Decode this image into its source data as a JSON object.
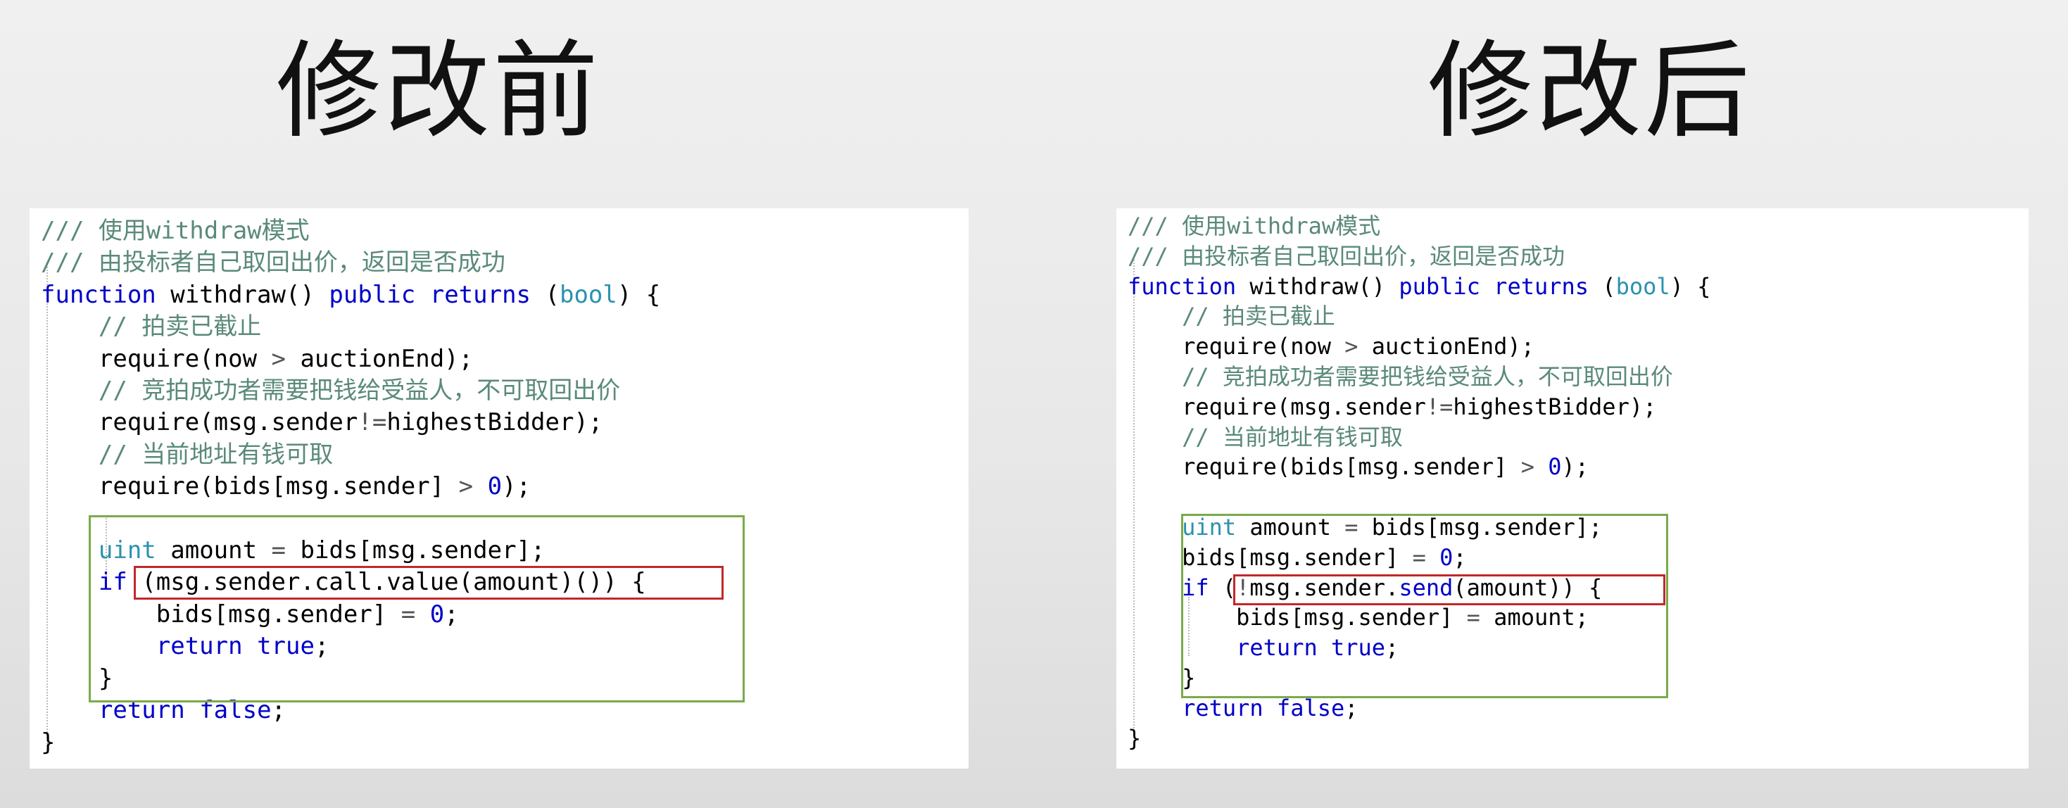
{
  "titles": {
    "before": "修改前",
    "after": "修改后"
  },
  "before": {
    "comment1": "/// 使用withdraw模式",
    "comment2": "/// 由投标者自己取回出价，返回是否成功",
    "kw_function": "function",
    "fn_name": " withdraw() ",
    "kw_public": "public",
    "kw_returns": "returns",
    "paren_open": " (",
    "tp_bool": "bool",
    "paren_close": ") {",
    "indent": "    ",
    "indent2": "        ",
    "comment3": "// 拍卖已截止",
    "req1_a": "require(now ",
    "gt": ">",
    "req1_b": " auctionEnd);",
    "comment4": "// 竞拍成功者需要把钱给受益人，不可取回出价",
    "req2_a": "require(msg.sender",
    "neq": "!=",
    "req2_b": "highestBidder);",
    "comment5": "// 当前地址有钱可取",
    "req3_a": "require(bids[msg.sender] ",
    "zero": "0",
    "req3_b": ");",
    "tp_uint": "uint",
    "amount_a": " amount ",
    "eq": "=",
    "amount_b": " bids[msg.sender];",
    "kw_if": "if",
    "if_cond": " (msg.sender.call.value(amount)()) {",
    "bids_a": "bids[msg.sender] ",
    "semi": ";",
    "kw_return": "return",
    "kw_true": " true",
    "close_brace": "}",
    "kw_false": " false"
  },
  "after": {
    "comment1": "/// 使用withdraw模式",
    "comment2": "/// 由投标者自己取回出价，返回是否成功",
    "kw_function": "function",
    "fn_name": " withdraw() ",
    "kw_public": "public",
    "kw_returns": "returns",
    "paren_open": " (",
    "tp_bool": "bool",
    "paren_close": ") {",
    "indent": "    ",
    "indent2": "        ",
    "comment3": "// 拍卖已截止",
    "req1_a": "require(now ",
    "gt": ">",
    "req1_b": " auctionEnd);",
    "comment4": "// 竞拍成功者需要把钱给受益人，不可取回出价",
    "req2_a": "require(msg.sender",
    "neq": "!=",
    "req2_b": "highestBidder);",
    "comment5": "// 当前地址有钱可取",
    "req3_a": "require(bids[msg.sender] ",
    "zero": "0",
    "req3_b": ");",
    "tp_uint": "uint",
    "amount_a": " amount ",
    "eq": "=",
    "amount_b": " bids[msg.sender];",
    "bids_a": "bids[msg.sender] ",
    "semi": ";",
    "kw_if": "if",
    "if_open": " (",
    "not": "!",
    "if_mid": "msg.sender.",
    "send": "send",
    "if_end": "(amount)) {",
    "bids_amount": " amount;",
    "kw_return": "return",
    "kw_true": " true",
    "close_brace": "}",
    "kw_false": " false"
  },
  "colors": {
    "keyword": "#0000c8",
    "type": "#2b91af",
    "comment": "#5a8a78",
    "highlight_green": "#7aaa4a",
    "highlight_red": "#c0282a"
  }
}
